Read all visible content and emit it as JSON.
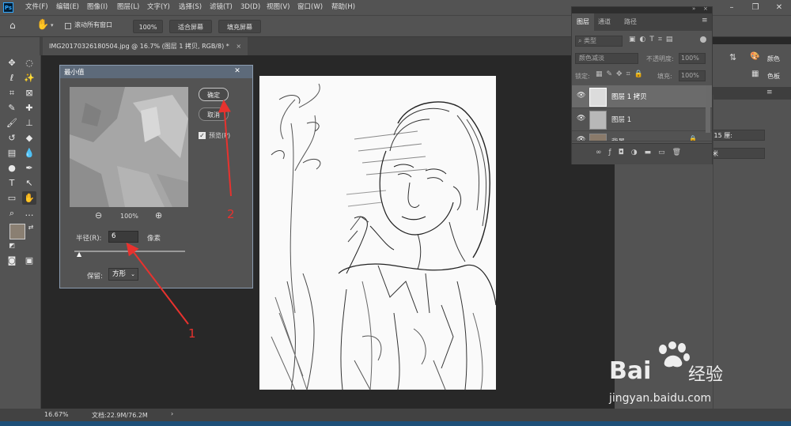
{
  "app": {
    "logo": "Ps"
  },
  "menu": [
    "文件(F)",
    "编辑(E)",
    "图像(I)",
    "图层(L)",
    "文字(Y)",
    "选择(S)",
    "滤镜(T)",
    "3D(D)",
    "视图(V)",
    "窗口(W)",
    "帮助(H)"
  ],
  "options": {
    "scroll_all": "滚动所有窗口",
    "zoom": "100%",
    "fit_screen": "适合屏幕",
    "fill_screen": "填充屏幕"
  },
  "document": {
    "tab_title": "IMG20170326180504.jpg @ 16.7% (图层 1 拷贝, RGB/8) *",
    "close": "×"
  },
  "dialog": {
    "title": "最小值",
    "ok": "确定",
    "cancel": "取消",
    "preview_label": "预览(P)",
    "zoom_level": "100%",
    "radius_label": "半径(R):",
    "radius_value": "6",
    "radius_unit": "像素",
    "preserve_label": "保留:",
    "preserve_value": "方形",
    "slider_fraction": 0.05
  },
  "layers": {
    "tabs": [
      "图层",
      "通道",
      "路径"
    ],
    "filter_kind": "类型",
    "blend_mode": "颜色减淡",
    "opacity_label": "不透明度:",
    "opacity_value": "100%",
    "lock_label": "锁定:",
    "fill_label": "填充:",
    "fill_value": "100%",
    "items": [
      {
        "name": "图层 1 拷贝",
        "selected": true
      },
      {
        "name": "图层 1",
        "selected": false
      },
      {
        "name": "背景",
        "selected": false
      }
    ]
  },
  "right_strip": {
    "color": "颜色",
    "swatches": "色板"
  },
  "properties": {
    "value_fragment": ".15 厘:",
    "unit_fragment": "米"
  },
  "status": {
    "zoom": "16.67%",
    "doc_size": "文档:22.9M/76.2M"
  },
  "annotations": [
    {
      "label": "1"
    },
    {
      "label": "2"
    }
  ],
  "watermark": {
    "brand": "Bai",
    "brand_cn": "经验",
    "url": "jingyan.baidu.com"
  },
  "colors": {
    "annotation": "#e8322e",
    "ps_blue": "#31a8ff",
    "panel": "#535353"
  }
}
